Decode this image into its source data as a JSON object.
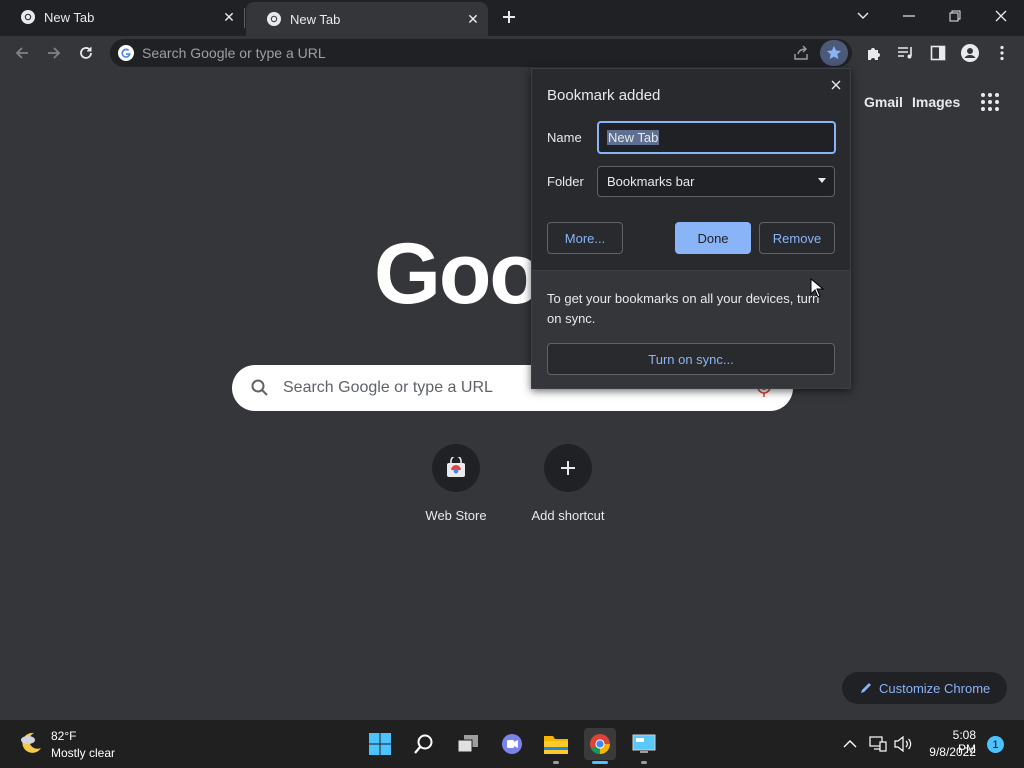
{
  "tabs": [
    {
      "title": "New Tab"
    },
    {
      "title": "New Tab"
    }
  ],
  "omnibox": {
    "placeholder": "Search Google or type a URL"
  },
  "page": {
    "gmail": "Gmail",
    "images": "Images",
    "logo_text": "Goo",
    "search_placeholder": "Search Google or type a URL",
    "shortcuts": [
      {
        "label": "Web Store",
        "icon": "web-store-icon"
      },
      {
        "label": "Add shortcut",
        "icon": "plus-icon"
      }
    ],
    "customize": "Customize Chrome"
  },
  "bookmark_bubble": {
    "title": "Bookmark added",
    "name_label": "Name",
    "name_value": "New Tab",
    "folder_label": "Folder",
    "folder_value": "Bookmarks bar",
    "more": "More...",
    "done": "Done",
    "remove": "Remove",
    "sync_text": "To get your bookmarks on all your devices, turn on sync.",
    "sync_button": "Turn on sync..."
  },
  "taskbar": {
    "weather_temp": "82°F",
    "weather_desc": "Mostly clear",
    "time": "5:08 PM",
    "date": "9/8/2022",
    "notifications": "1"
  },
  "colors": {
    "accent": "#8ab4f8",
    "chrome_bg": "#35363a",
    "frame_bg": "#202124",
    "taskbar_accent": "#4cc2ff"
  }
}
